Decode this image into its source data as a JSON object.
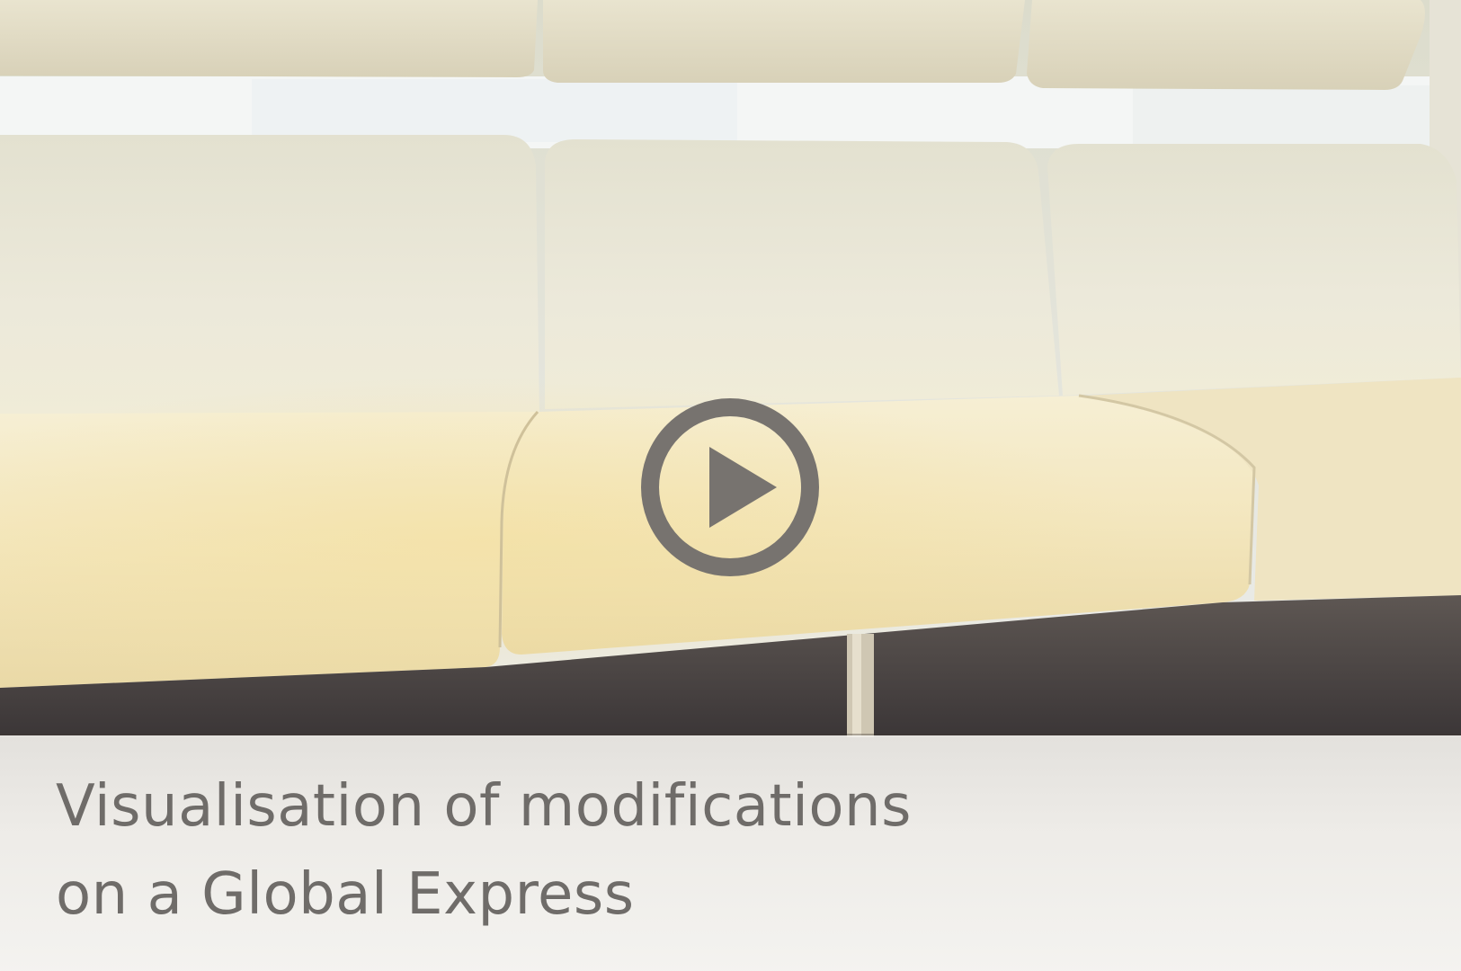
{
  "video": {
    "caption_lines": [
      "Visualisation of modifications",
      "on a Global Express"
    ]
  },
  "icons": {
    "play": "play-icon"
  },
  "colors": {
    "play_button": "#77736f",
    "caption_text": "#6f6c69",
    "caption_band": "#f4f2ee",
    "seat_upholstery": "#ece3c4",
    "carpet": "#3e3a3a"
  }
}
